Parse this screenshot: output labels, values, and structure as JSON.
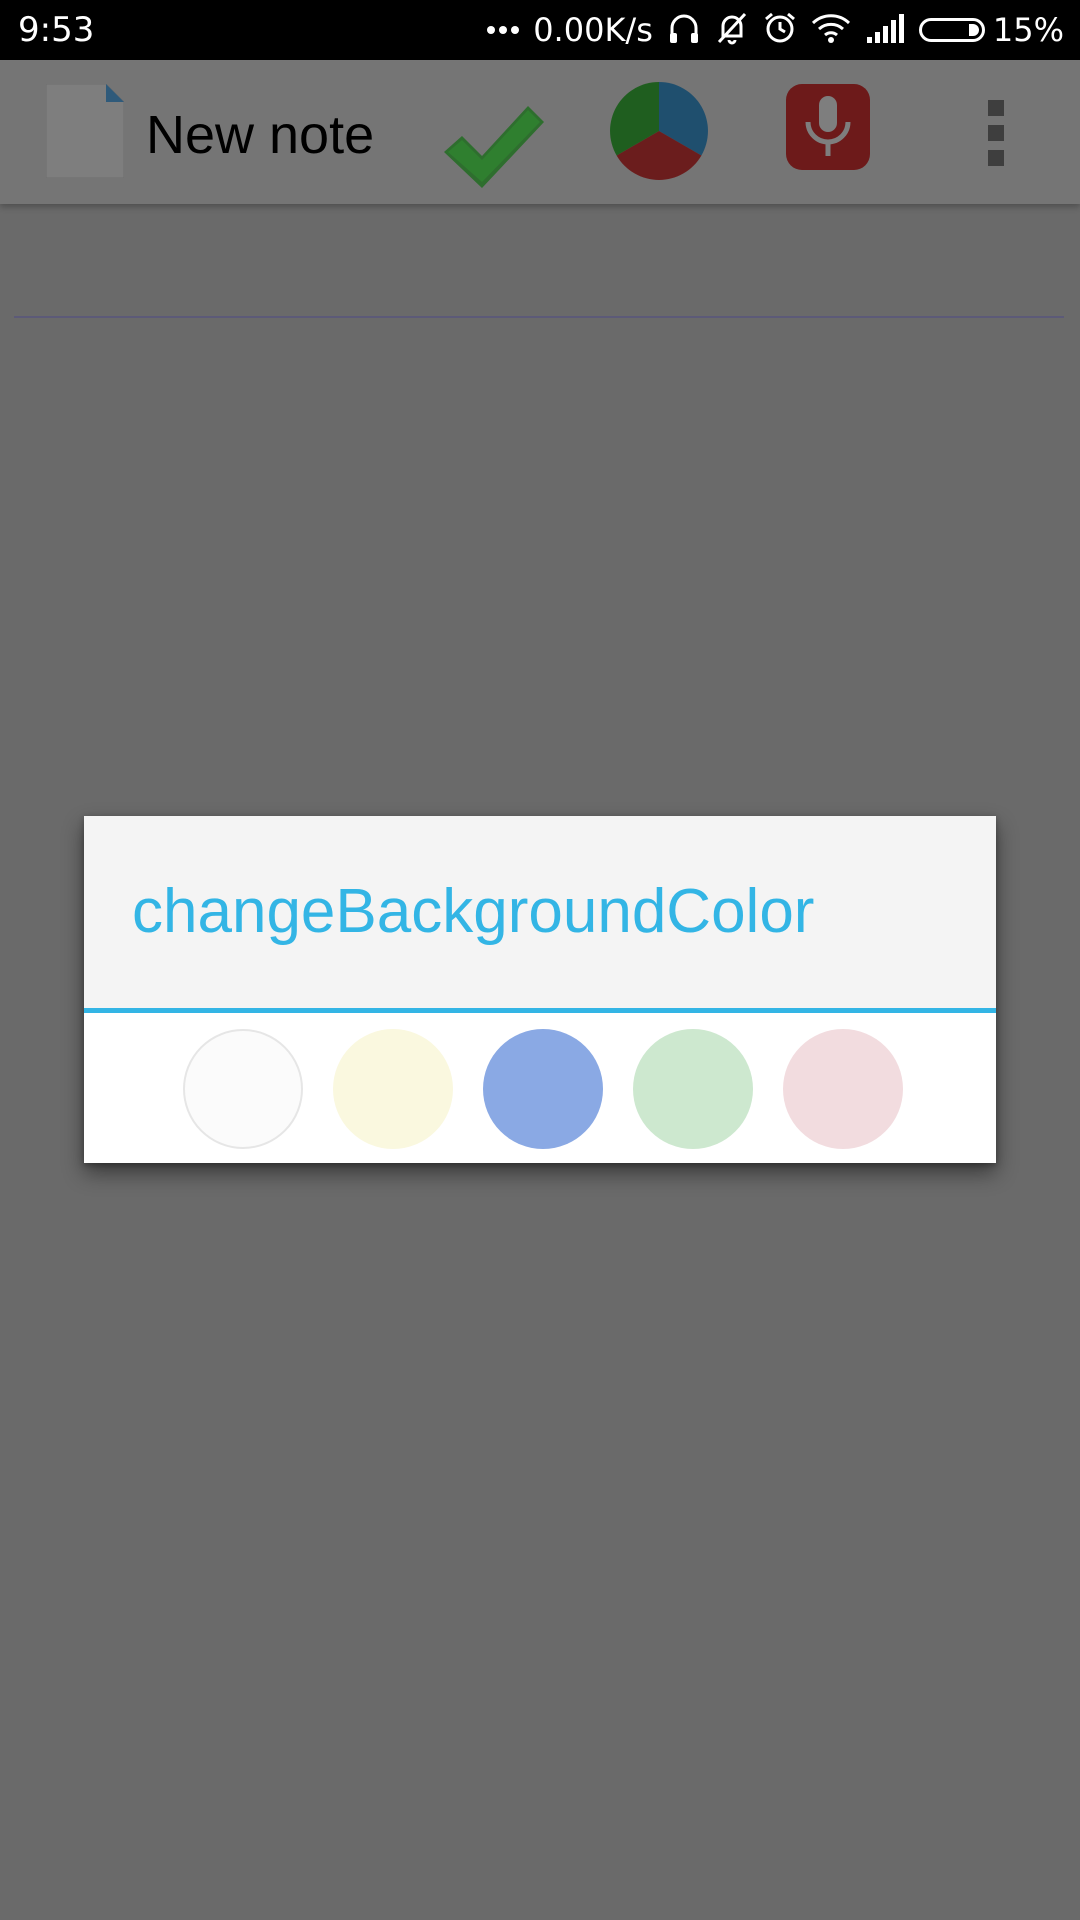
{
  "status_bar": {
    "time": "9:53",
    "network_speed": "0.00K/s",
    "battery_percent": "15%",
    "icons": [
      "more-dots-icon",
      "headphones-icon",
      "muted-bell-icon",
      "alarm-icon",
      "wifi-icon",
      "signal-icon",
      "battery-icon"
    ]
  },
  "toolbar": {
    "title": "New note",
    "icons": [
      "note-icon",
      "checkmark-icon",
      "pie-chart-icon",
      "microphone-icon",
      "overflow-menu-icon"
    ]
  },
  "dialog": {
    "title": "changeBackgroundColor",
    "accent_color": "#33b5e5",
    "color_options": [
      {
        "name": "white",
        "color": "#fbfbfb"
      },
      {
        "name": "yellow",
        "color": "#faf8df"
      },
      {
        "name": "blue",
        "color": "#8aa9e4"
      },
      {
        "name": "green",
        "color": "#cde8cf"
      },
      {
        "name": "pink",
        "color": "#f2dcdf"
      }
    ]
  },
  "colors": {
    "dim_background": "#6a6a6a",
    "status_bar": "#000000",
    "checkmark": "#2e8b2e",
    "microphone": "#b22222"
  }
}
